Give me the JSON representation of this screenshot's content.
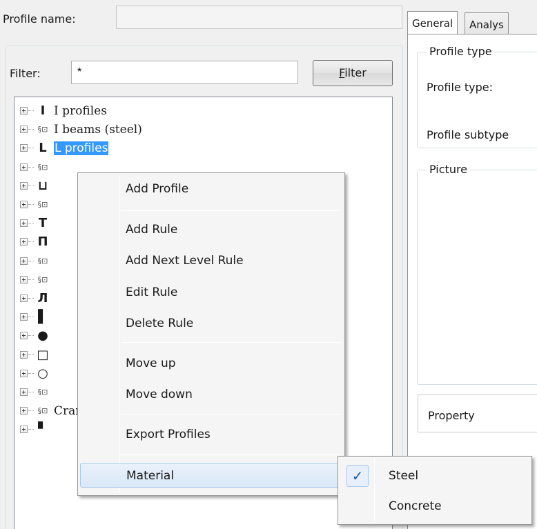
{
  "profile": {
    "label": "Profile name:",
    "value": ""
  },
  "filter": {
    "label": "Filter:",
    "value": "*",
    "button_label": "Filter",
    "button_mnemonic": "F"
  },
  "tree": {
    "items": [
      {
        "icon": "I-beam-icon",
        "glyph": "I",
        "label": "I profiles"
      },
      {
        "icon": "parametric-profile-icon",
        "glyph": "§⊡",
        "label": "I beams (steel)"
      },
      {
        "icon": "angle-profile-icon",
        "glyph": "L",
        "label": "L profiles",
        "selected": true
      },
      {
        "icon": "parametric-profile-icon",
        "glyph": "§⊡",
        "label": ""
      },
      {
        "icon": "channel-profile-icon",
        "glyph": "⊔",
        "label": ""
      },
      {
        "icon": "parametric-profile-icon",
        "glyph": "§⊡",
        "label": ""
      },
      {
        "icon": "T-profile-icon",
        "glyph": "T",
        "label": ""
      },
      {
        "icon": "double-T-profile-icon",
        "glyph": "Π",
        "label": ""
      },
      {
        "icon": "parametric-profile-icon",
        "glyph": "§⊡",
        "label": ""
      },
      {
        "icon": "parametric-profile-icon",
        "glyph": "§⊡",
        "label": ""
      },
      {
        "icon": "hat-profile-icon",
        "glyph": "Л",
        "label": ""
      },
      {
        "icon": "flat-bar-icon",
        "glyph": "▌",
        "label": ""
      },
      {
        "icon": "round-bar-icon",
        "glyph": "●",
        "label": ""
      },
      {
        "icon": "rectangular-hollow-icon",
        "glyph": "□",
        "label": ""
      },
      {
        "icon": "circular-hollow-icon",
        "glyph": "○",
        "label": ""
      },
      {
        "icon": "parametric-profile-icon",
        "glyph": "§⊡",
        "label": ""
      },
      {
        "icon": "parametric-profile-icon",
        "glyph": "§⊡",
        "label": "Crane rails"
      },
      {
        "icon": "cold-rolled-icon",
        "glyph": "▘",
        "label": ""
      }
    ]
  },
  "tabs": [
    {
      "label": "General",
      "active": true
    },
    {
      "label": "Analys",
      "active": false
    }
  ],
  "right": {
    "profile_type_group": "Profile type",
    "profile_type_label": "Profile type:",
    "profile_subtype_label": "Profile subtype",
    "picture_group": "Picture",
    "property_header": "Property"
  },
  "context_menu": {
    "add_profile": "Add Profile",
    "add_rule": "Add Rule",
    "add_next_level_rule": "Add Next Level Rule",
    "edit_rule": "Edit Rule",
    "delete_rule": "Delete Rule",
    "move_up": "Move up",
    "move_down": "Move down",
    "export_profiles": "Export Profiles",
    "material": "Material"
  },
  "material_submenu": {
    "steel": "Steel",
    "concrete": "Concrete",
    "checked": "Steel",
    "check_glyph": "✓"
  },
  "colors": {
    "selection": "#3399ff",
    "menu_highlight": "#d9e7f7"
  }
}
